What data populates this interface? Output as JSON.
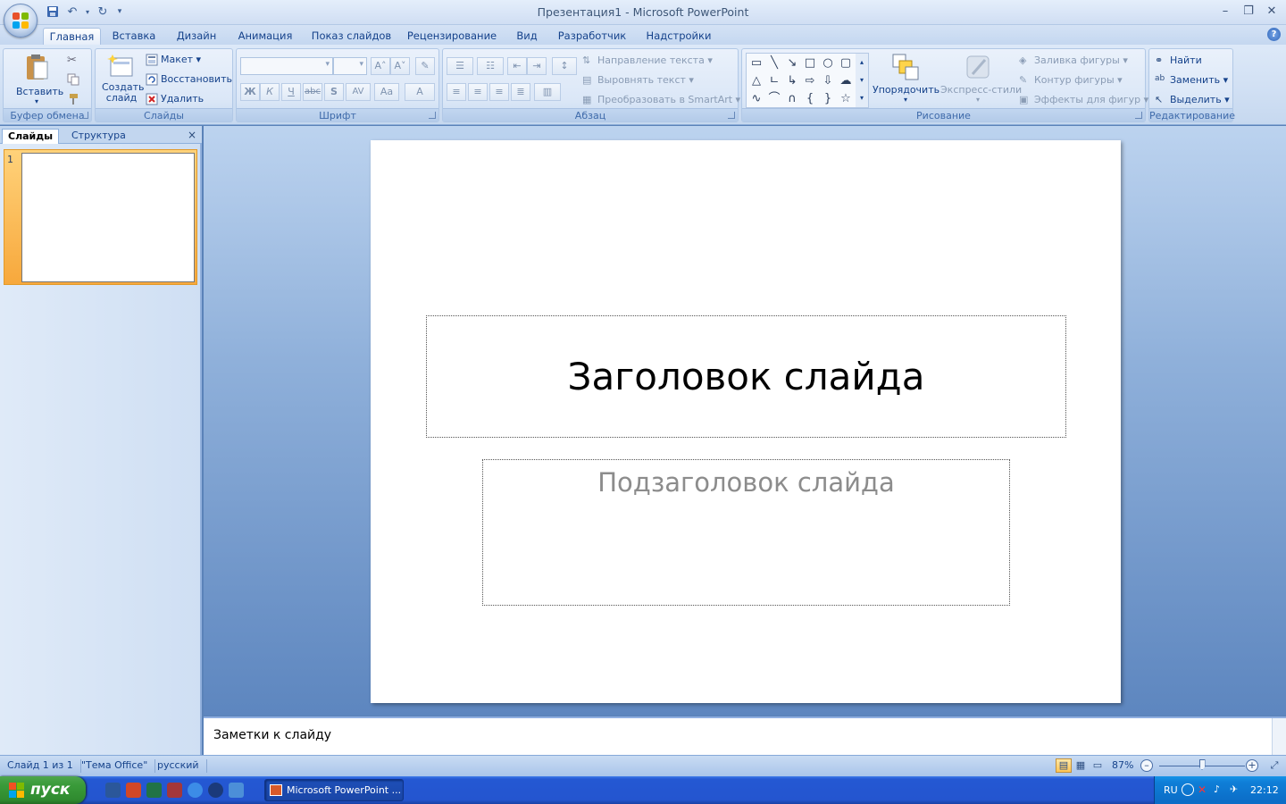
{
  "window": {
    "title": "Презентация1 - Microsoft PowerPoint",
    "minimize": "–",
    "maximize": "❐",
    "close": "✕"
  },
  "tabs": [
    "Главная",
    "Вставка",
    "Дизайн",
    "Анимация",
    "Показ слайдов",
    "Рецензирование",
    "Вид",
    "Разработчик",
    "Надстройки"
  ],
  "ribbon": {
    "clipboard": {
      "label": "Буфер обмена",
      "paste": "Вставить"
    },
    "slides": {
      "label": "Слайды",
      "new_slide": "Создать слайд",
      "layout": "Макет",
      "reset": "Восстановить",
      "delete": "Удалить"
    },
    "font": {
      "label": "Шрифт",
      "bold": "Ж",
      "italic": "К",
      "underline": "Ч",
      "strike": "abc",
      "shadow": "S",
      "spacing": "AV",
      "case": "Aa",
      "color": "A"
    },
    "paragraph": {
      "label": "Абзац",
      "text_direction": "Направление текста",
      "align_text": "Выровнять текст",
      "smartart": "Преобразовать в SmartArt"
    },
    "drawing": {
      "label": "Рисование",
      "arrange": "Упорядочить",
      "quick_styles": "Экспресс-стили",
      "fill": "Заливка фигуры",
      "outline": "Контур фигуры",
      "effects": "Эффекты для фигур"
    },
    "editing": {
      "label": "Редактирование",
      "find": "Найти",
      "replace": "Заменить",
      "select": "Выделить"
    }
  },
  "left_panel": {
    "tab_slides": "Слайды",
    "tab_outline": "Структура",
    "close": "×",
    "thumbnails": [
      {
        "number": "1"
      }
    ]
  },
  "slide": {
    "title": "Заголовок слайда",
    "subtitle": "Подзаголовок слайда"
  },
  "notes": {
    "placeholder": "Заметки к слайду"
  },
  "status": {
    "slide_count": "Слайд 1 из 1",
    "theme": "\"Тема Office\"",
    "language": "русский",
    "zoom": "87%",
    "zoom_level_fraction": 0.5
  },
  "taskbar": {
    "start": "пуск",
    "task_title": "Microsoft PowerPoint ...",
    "lang": "RU",
    "clock": "22:12"
  },
  "colors": {
    "ribbon_text": "#15428b",
    "accent_orange": "#f7a83c",
    "xp_blue": "#2458d3",
    "xp_green": "#3a9b3a"
  }
}
